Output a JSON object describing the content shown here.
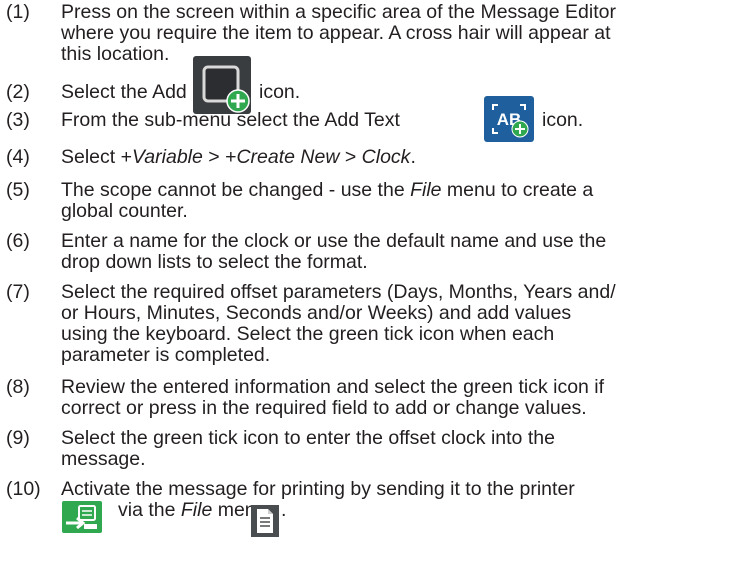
{
  "steps": [
    {
      "num": "(1)",
      "lines": [
        "Press on the screen within a specific area of the Message Editor",
        "where you require the item to appear. A cross hair will appear at",
        "this location."
      ]
    },
    {
      "num": "(2)",
      "pre": "Select the Add",
      "post": "icon."
    },
    {
      "num": "(3)",
      "pre": "From the sub-menu select the Add Text",
      "post": "icon."
    },
    {
      "num": "(4)",
      "parts": [
        "Select +",
        "Variable",
        " > +",
        "Create New",
        " > ",
        "Clock",
        "."
      ]
    },
    {
      "num": "(5)",
      "line1_a": "The scope cannot be changed - use the ",
      "line1_em": "File",
      "line1_b": " menu to create a",
      "line2": "global counter."
    },
    {
      "num": "(6)",
      "lines": [
        "Enter a name for the clock or use the default name and use the",
        "drop down lists to select the format."
      ]
    },
    {
      "num": "(7)",
      "lines": [
        "Select the required offset parameters (Days, Months, Years and/",
        "or Hours, Minutes, Seconds and/or Weeks) and add values",
        "using the keyboard. Select the green tick icon when each",
        "parameter is completed."
      ]
    },
    {
      "num": "(8)",
      "lines": [
        "Review the entered information and select the green tick icon if",
        "correct or press in the required field to add or change values."
      ]
    },
    {
      "num": "(9)",
      "lines": [
        "Select the green tick icon to enter the offset clock into the",
        "message."
      ]
    },
    {
      "num": "(10)",
      "line1": "Activate the message for printing by sending it to the printer",
      "l2_a": "via the ",
      "l2_em": "File",
      "l2_b": " menu",
      "l2_end": "."
    }
  ],
  "icons": {
    "add": "add-item-icon",
    "add_text": "add-text-icon",
    "add_text_glyph": "AB",
    "send_to_printer": "send-to-printer-icon",
    "file_menu": "file-menu-icon"
  },
  "colors": {
    "text": "#231f20",
    "green": "#2fa84f",
    "dark_tile": "#3a3d40",
    "blue_tile": "#1f5f9e"
  }
}
